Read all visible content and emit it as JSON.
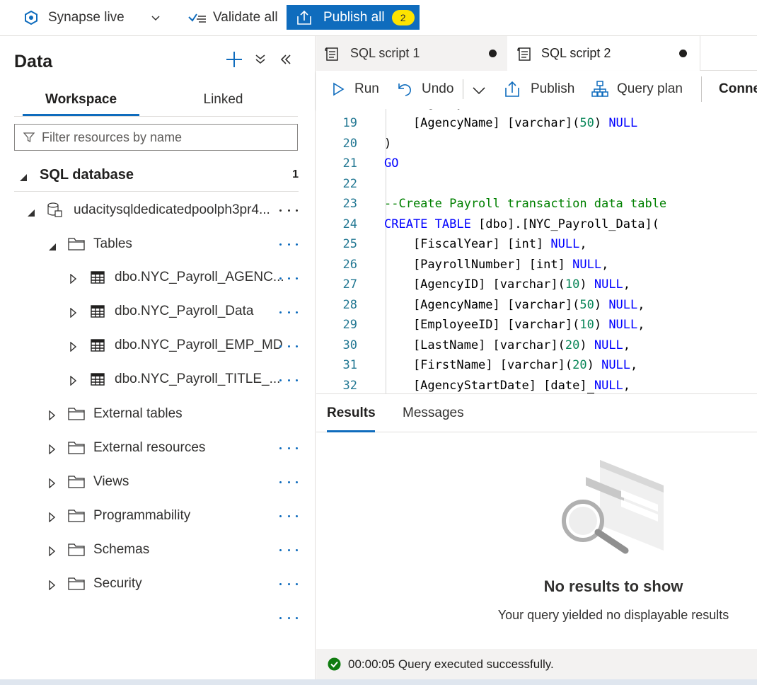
{
  "topbar": {
    "workspace": "Synapse live",
    "validate_label": "Validate all",
    "publish_label": "Publish all",
    "publish_count": "2"
  },
  "left_panel": {
    "title": "Data",
    "tabs": [
      "Workspace",
      "Linked"
    ],
    "filter_placeholder": "Filter resources by name",
    "section_label": "SQL database",
    "section_count": "1",
    "pool_name": "udacitysqldedicatedpoolph3pr4...",
    "tables_label": "Tables",
    "tables": [
      "dbo.NYC_Payroll_AGENC...",
      "dbo.NYC_Payroll_Data",
      "dbo.NYC_Payroll_EMP_MD",
      "dbo.NYC_Payroll_TITLE_..."
    ],
    "folders": [
      "External tables",
      "External resources",
      "Views",
      "Programmability",
      "Schemas",
      "Security"
    ]
  },
  "editor": {
    "tabs": [
      "SQL script 1",
      "SQL script 2"
    ],
    "toolbar": {
      "run": "Run",
      "undo": "Undo",
      "publish": "Publish",
      "query_plan": "Query plan",
      "connect": "Conne"
    },
    "line_numbers": [
      "19",
      "20",
      "21",
      "22",
      "23",
      "24",
      "25",
      "26",
      "27",
      "28",
      "29",
      "30",
      "31",
      "32"
    ]
  },
  "results": {
    "tabs": [
      "Results",
      "Messages"
    ],
    "empty_title": "No results to show",
    "empty_subtitle": "Your query yielded no displayable results"
  },
  "status": {
    "text": "00:00:05 Query executed successfully."
  },
  "colors": {
    "accent": "#0f6cbd",
    "badge": "#fde300",
    "keyword": "#0000ff",
    "comment": "#008000",
    "number": "#098658",
    "success": "#107c10"
  }
}
